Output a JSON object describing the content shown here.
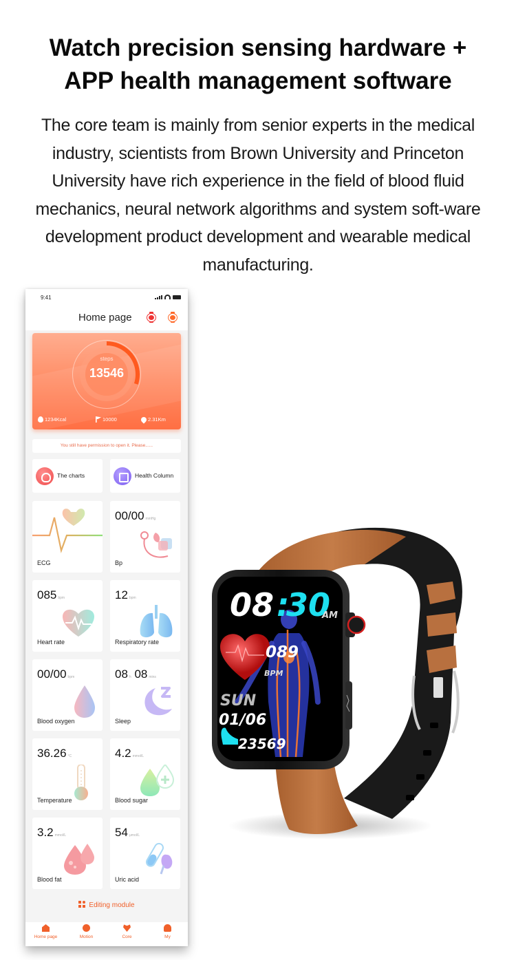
{
  "headline": {
    "line1": "Watch precision sensing hardware +",
    "line2": "APP health management software"
  },
  "intro": "The core team is mainly from senior experts in the medical industry, scientists from Brown University and Princeton University have rich experience in the field of blood fluid mechanics, neural network algorithms and system soft-ware development product development and wearable medical manufacturing.",
  "app": {
    "status_time": "9:41",
    "title": "Home page",
    "steps": {
      "label": "steps",
      "value": "13546",
      "goal_progress": 0.3,
      "calories": "1234Kcal",
      "goal": "10000",
      "distance": "2.31Km"
    },
    "notice": "You still have permission to open it. Please......",
    "shortcuts": [
      {
        "label": "The charts",
        "icon": "trophy-icon"
      },
      {
        "label": "Health Column",
        "icon": "health-column-icon"
      }
    ],
    "tiles": [
      {
        "name": "ECG",
        "value": "",
        "unit": ""
      },
      {
        "name": "Bp",
        "value": "00/00",
        "unit": "mmHg"
      },
      {
        "name": "Heart rate",
        "value": "085",
        "unit": "bpm"
      },
      {
        "name": "Respiratory rate",
        "value": "12",
        "unit": "bpm"
      },
      {
        "name": "Blood oxygen",
        "value": "00/00",
        "unit": "bpm"
      },
      {
        "name": "Sleep",
        "value": "08",
        "value2": "08",
        "unit_h": "h",
        "unit": "mins"
      },
      {
        "name": "Temperature",
        "value": "36.26",
        "unit": "°C"
      },
      {
        "name": "Blood sugar",
        "value": "4.2",
        "unit": "mmol/L"
      },
      {
        "name": "Blood fat",
        "value": "3.2",
        "unit": "mmol/L"
      },
      {
        "name": "Uric acid",
        "value": "54",
        "unit": "μmol/L"
      }
    ],
    "editing_module": "Editing module",
    "tabs": [
      {
        "label": "Home page",
        "icon": "home-icon"
      },
      {
        "label": "Motion",
        "icon": "motion-icon"
      },
      {
        "label": "Core",
        "icon": "heart-icon"
      },
      {
        "label": "My",
        "icon": "user-icon"
      }
    ],
    "accent": "#f0602a"
  },
  "watch": {
    "hour": "08",
    "minute": "30",
    "ampm": "AM",
    "heart_rate": "089",
    "heart_unit": "BPM",
    "day": "SUN",
    "date": "01/06",
    "steps": "23569",
    "strap_color": "#b8703f",
    "accent": "#1ee0f0"
  }
}
